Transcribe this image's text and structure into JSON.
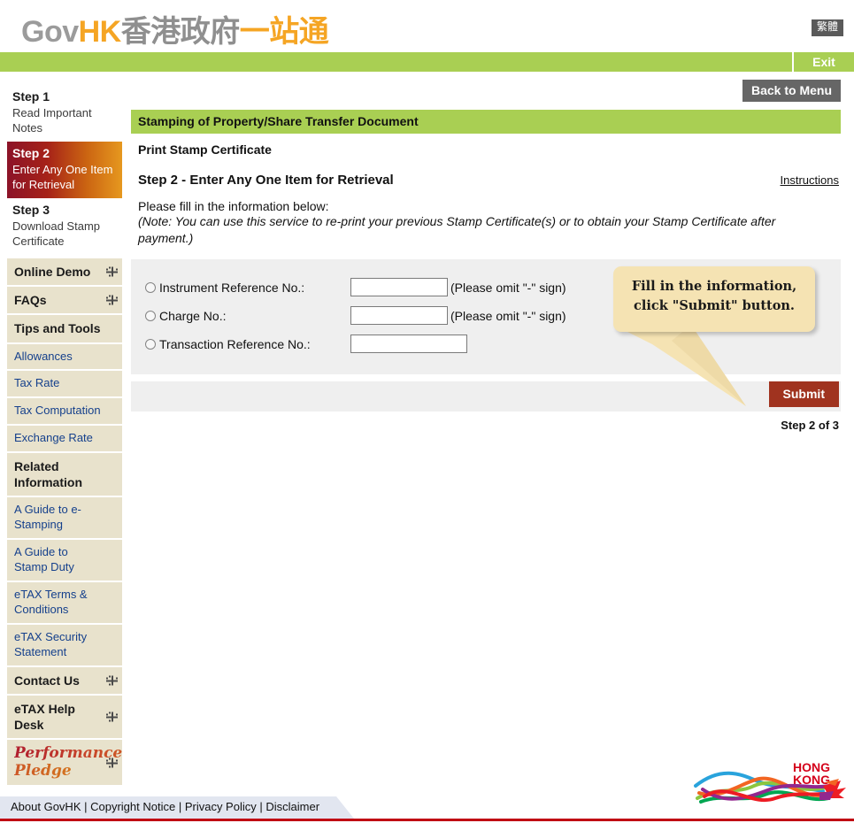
{
  "header": {
    "logo": {
      "gov": "Gov",
      "hk": "HK",
      "cn_gray": "香港政府",
      "cn_orange": "一站通"
    },
    "lang_button": "繁體",
    "exit_button": "Exit"
  },
  "sidebar": {
    "steps": [
      {
        "num": "Step 1",
        "desc": "Read Important Notes",
        "active": false
      },
      {
        "num": "Step 2",
        "desc": "Enter Any One Item for Retrieval",
        "active": true
      },
      {
        "num": "Step 3",
        "desc": "Download Stamp Certificate",
        "active": false
      }
    ],
    "nav": [
      {
        "label": "Online Demo",
        "type": "head",
        "expand": true
      },
      {
        "label": "FAQs",
        "type": "head",
        "expand": true
      },
      {
        "label": "Tips and Tools",
        "type": "head",
        "expand": false
      },
      {
        "label": "Allowances",
        "type": "link",
        "expand": false
      },
      {
        "label": "Tax Rate",
        "type": "link",
        "expand": false
      },
      {
        "label": "Tax Computation",
        "type": "link",
        "expand": false
      },
      {
        "label": "Exchange Rate",
        "type": "link",
        "expand": false
      },
      {
        "label": "Related Information",
        "type": "head",
        "expand": false
      },
      {
        "label": "A Guide to e-Stamping",
        "type": "link",
        "expand": false
      },
      {
        "label": "A Guide to Stamp Duty",
        "type": "link",
        "expand": false
      },
      {
        "label": "eTAX Terms & Conditions",
        "type": "link",
        "expand": false
      },
      {
        "label": "eTAX Security Statement",
        "type": "link",
        "expand": false
      },
      {
        "label": "Contact Us",
        "type": "head",
        "expand": true
      },
      {
        "label": "eTAX Help Desk",
        "type": "head",
        "expand": true
      },
      {
        "label": "Performance Pledge",
        "type": "pledge",
        "expand": true
      }
    ]
  },
  "main": {
    "back_button": "Back to Menu",
    "title_bar": "Stamping of Property/Share Transfer Document",
    "subtitle": "Print Stamp Certificate",
    "step_heading": "Step 2 - Enter Any One Item for Retrieval",
    "instructions_link": "Instructions",
    "fill_text": "Please fill in the information below:",
    "note_text": "(Note: You can use this service to re-print your previous Stamp Certificate(s) or to obtain your Stamp Certificate after payment.)",
    "form": {
      "rows": [
        {
          "label": "Instrument Reference No.:",
          "value": "",
          "hint": "(Please omit \"-\" sign)",
          "width": "w1"
        },
        {
          "label": "Charge No.:",
          "value": "",
          "hint": "(Please omit \"-\" sign)",
          "width": "w1"
        },
        {
          "label": "Transaction Reference No.:",
          "value": "",
          "hint": "",
          "width": "w2"
        }
      ]
    },
    "callout": {
      "line1": "Fill in the information,",
      "line2": "click \"Submit\" button."
    },
    "submit_button": "Submit",
    "step_counter": "Step 2 of 3"
  },
  "brand": {
    "hong": "HONG",
    "kong": "KONG"
  },
  "footer": {
    "links": [
      "About GovHK",
      "Copyright Notice",
      "Privacy Policy",
      "Disclaimer"
    ],
    "separator": "|"
  },
  "colors": {
    "green": "#a9cf53",
    "orange": "#f5a524",
    "dark_red": "#a0331f",
    "link_blue": "#15408c",
    "sidebar_beige": "#e8e2cc",
    "brand_red": "#c00012"
  }
}
